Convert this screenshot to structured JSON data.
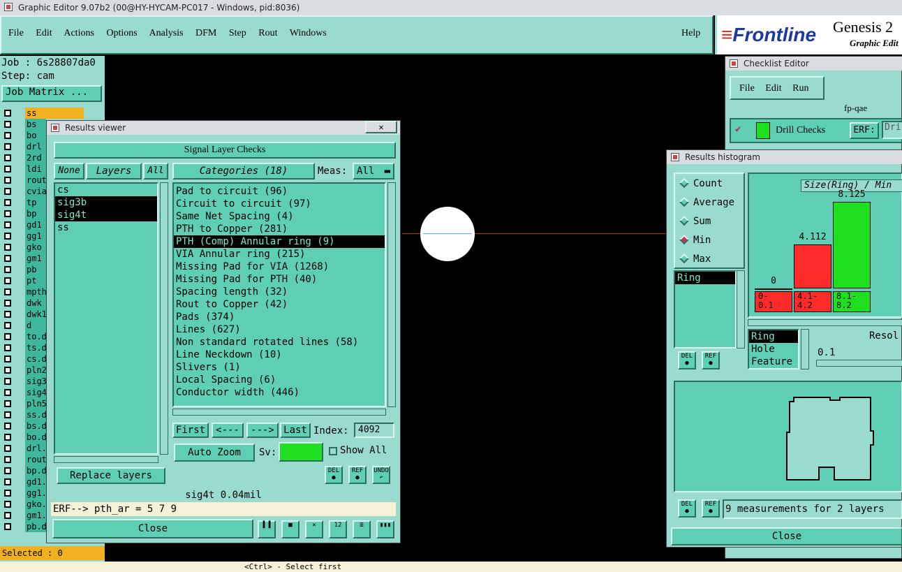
{
  "window_title": "Graphic Editor 9.07b2 (00@HY-HYCAM-PC017 - Windows, pid:8036)",
  "menu": [
    "File",
    "Edit",
    "Actions",
    "Options",
    "Analysis",
    "DFM",
    "Step",
    "Rout",
    "Windows"
  ],
  "help": "Help",
  "brand": {
    "logo": "Frontline",
    "product": "Genesis 2",
    "subtitle": "Graphic Edit"
  },
  "job_label": "Job : 6s28807da0",
  "step_label": "Step: cam",
  "job_matrix": "Job Matrix ...",
  "layers": [
    "ss",
    "bs",
    "bo",
    "drl",
    "2rd",
    "ldi",
    "rout",
    "cvia",
    "tp",
    "bp",
    "gd1",
    "gg1",
    "gko",
    "gm1",
    "pb",
    "pt",
    "mpth",
    "dwk",
    "dwk1",
    "d",
    "to.d",
    "ts.d",
    "cs.d",
    "pln2",
    "sig3",
    "sig4",
    "pln5",
    "ss.d",
    "bs.d",
    "bo.d",
    "drl.",
    "rout",
    "bp.d",
    "gd1.",
    "gg1.",
    "gko.",
    "gm1.",
    "pb.d"
  ],
  "selected_label": "Selected : 0",
  "results_viewer": {
    "title": "Results viewer",
    "close_x": "✕",
    "header": "Signal Layer Checks",
    "none_btn": "None",
    "layers_btn": "Layers",
    "all_btn": "All",
    "layer_list": [
      "cs",
      "sig3b",
      "sig4t",
      "ss"
    ],
    "categories_label": "Categories (18)",
    "meas_label": "Meas:",
    "meas_value": "All",
    "categories": [
      "Pad to circuit (96)",
      "Circuit to circuit (97)",
      "Same Net Spacing (4)",
      "PTH to Copper (281)",
      "PTH (Comp) Annular ring (9)",
      "VIA Annular ring (215)",
      "Missing Pad for VIA (1268)",
      "Missing Pad for PTH (40)",
      "Spacing length (32)",
      "Rout to Copper (42)",
      "Pads (374)",
      "Lines (627)",
      "Non standard rotated lines (58)",
      "Line Neckdown (10)",
      "Slivers (1)",
      "Local Spacing (6)",
      "Conductor width (446)"
    ],
    "first_btn": "First",
    "prev_btn": "<---",
    "next_btn": "--->",
    "last_btn": "Last",
    "index_label": "Index:",
    "index_value": "4092",
    "auto_zoom": "Auto Zoom",
    "sv_label": "Sv:",
    "show_all": "Show All",
    "replace_layers": "Replace layers",
    "status": "sig4t 0.04mil",
    "erf": "ERF--> pth_ar = 5 7 9",
    "close": "Close",
    "del": "DEL",
    "ref": "REF",
    "undo": "UNDO"
  },
  "checklist": {
    "title": "Checklist Editor",
    "menu": [
      "File",
      "Edit",
      "Run"
    ],
    "name": "fp-qae",
    "drill_checks": "Drill Checks",
    "erf": "ERF:",
    "erf_value": "Dri"
  },
  "histogram": {
    "title": "Results histogram",
    "options": [
      "Count",
      "Average",
      "Sum",
      "Min",
      "Max"
    ],
    "selected_option": "Min",
    "list": [
      "Ring"
    ],
    "chart_title": "Size(Ring) / Min",
    "bars": [
      {
        "value": 0,
        "label": "0",
        "range": "0-\n0.1",
        "color": "#ff2a2a"
      },
      {
        "value": 4.112,
        "label": "4.112",
        "range": "4.1-\n4.2",
        "color": "#ff2a2a"
      },
      {
        "value": 8.125,
        "label": "8.125",
        "range": "8.1-\n8.2",
        "color": "#1ee01e"
      }
    ],
    "ymax": 8.125,
    "types": [
      "Ring",
      "Hole",
      "Feature"
    ],
    "resol_label": "Resol",
    "resol_value": "0.1",
    "measurements": "9 measurements for 2 layers",
    "close": "Close",
    "del": "DEL",
    "ref": "REF"
  },
  "bottom": {
    "hint": "<Ctrl> - Select first"
  },
  "colors": {
    "teal": "#5ecfb4",
    "light_teal": "#9adbd0",
    "highlight": "#000000",
    "accent_green": "#1ee01e",
    "accent_red": "#ff2a2a"
  }
}
